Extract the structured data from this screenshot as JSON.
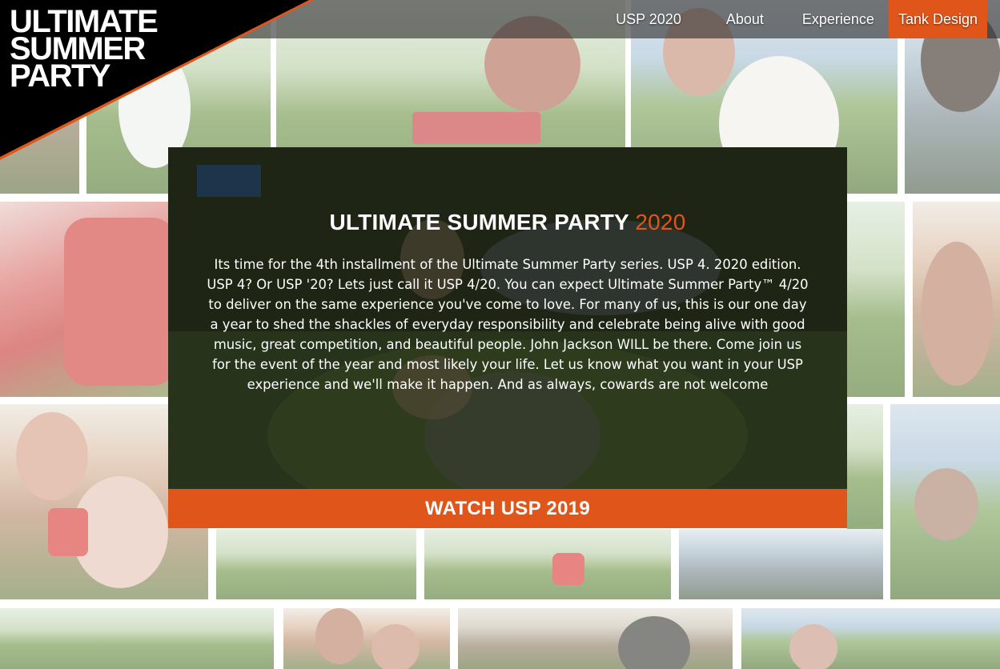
{
  "brand": {
    "logo_lines": [
      "ULTIMATE",
      "SUMMER",
      "PARTY"
    ]
  },
  "nav": {
    "items": [
      {
        "label": "USP 2020"
      },
      {
        "label": "About"
      },
      {
        "label": "Experience"
      },
      {
        "label": "Tank Design",
        "active": true
      }
    ]
  },
  "hero": {
    "title": "ULTIMATE SUMMER PARTY",
    "title_year": "2020",
    "body": "Its time for the 4th installment of the Ultimate Summer Party series. USP 4. 2020 edition. USP 4? Or USP '20? Lets just call it USP 4/20. You can expect Ultimate Summer Party™ 4/20 to deliver on the same experience you've come to love. For many of us, this is our one day a year to shed the shackles of everyday responsibility and celebrate being alive with good music, great competition, and beautiful people. John Jackson WILL be there. Come join us for the event of the year and most likely your life. Let us know what you want in your USP experience and we'll make it happen. And as always, cowards are not welcome",
    "cta_label": "WATCH USP 2019"
  },
  "colors": {
    "accent": "#e0561a",
    "nav_bg": "#2d2d2d",
    "logo_bg": "#000000"
  },
  "icons": {
    "background": "photo-collage"
  }
}
